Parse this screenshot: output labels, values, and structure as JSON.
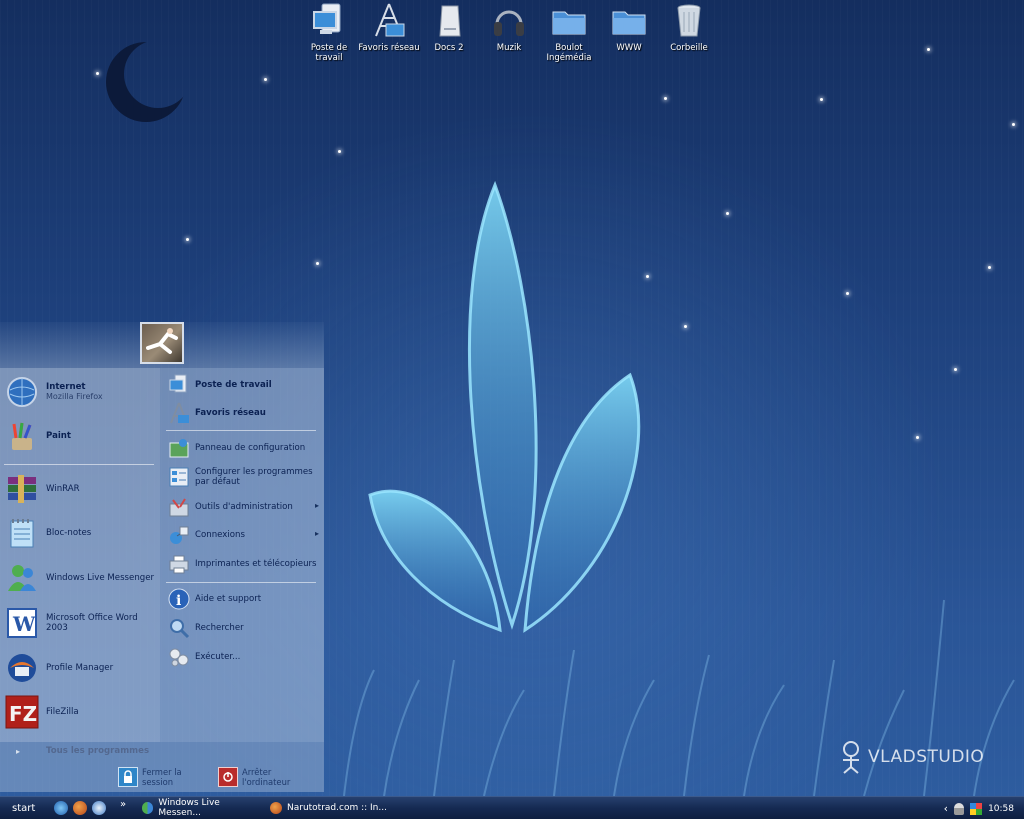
{
  "desktop": {
    "icons": [
      {
        "label": "Poste de\ntravail",
        "icon": "computer-icon"
      },
      {
        "label": "Favoris réseau",
        "icon": "network-icon"
      },
      {
        "label": "Docs 2",
        "icon": "drive-icon"
      },
      {
        "label": "Muzik",
        "icon": "headphones-icon"
      },
      {
        "label": "Boulot\nIngémédia",
        "icon": "folder-icon"
      },
      {
        "label": "WWW",
        "icon": "folder-icon"
      },
      {
        "label": "Corbeille",
        "icon": "recycle-bin-icon"
      }
    ],
    "watermark": "VLADSTUDIO"
  },
  "start_menu": {
    "pinned": [
      {
        "title": "Internet",
        "subtitle": "Mozilla Firefox"
      },
      {
        "title": "Paint"
      }
    ],
    "recent": [
      {
        "label": "WinRAR"
      },
      {
        "label": "Bloc-notes"
      },
      {
        "label": "Windows Live Messenger"
      },
      {
        "label": "Microsoft Office Word 2003"
      },
      {
        "label": "Profile Manager"
      },
      {
        "label": "FileZilla"
      }
    ],
    "all_programs": "Tous les programmes",
    "right": {
      "poste": "Poste de travail",
      "favoris": "Favoris réseau",
      "panneau": "Panneau de configuration",
      "configurer": "Configurer les programmes par défaut",
      "outils": "Outils d'administration",
      "connexions": "Connexions",
      "imprimantes": "Imprimantes et télécopieurs",
      "aide": "Aide et support",
      "rechercher": "Rechercher",
      "executer": "Exécuter..."
    },
    "logoff": "Fermer la session",
    "shutdown": "Arrêter l'ordinateur"
  },
  "taskbar": {
    "start": "start",
    "chevron": "»",
    "buttons": [
      {
        "label": "Windows Live Messen..."
      },
      {
        "label": "Narutotrad.com :: In..."
      }
    ],
    "tray_expand": "‹",
    "clock": "10:58"
  },
  "colors": {
    "accent": "#2e5da0",
    "menu_text": "#0b2152"
  }
}
